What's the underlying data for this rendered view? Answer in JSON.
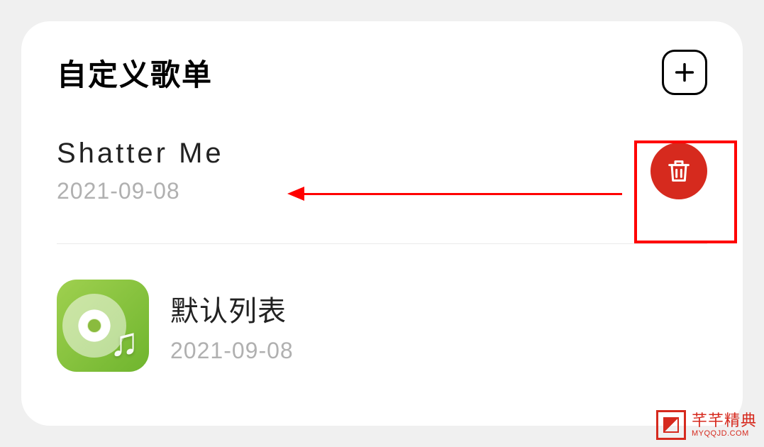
{
  "header": {
    "title": "自定义歌单"
  },
  "playlists": [
    {
      "name": "Shatter Me",
      "date": "2021-09-08"
    },
    {
      "name": "默认列表",
      "date": "2021-09-08"
    }
  ],
  "watermark": {
    "cn": "芊芊精典",
    "en": "MYQQJD.COM"
  }
}
